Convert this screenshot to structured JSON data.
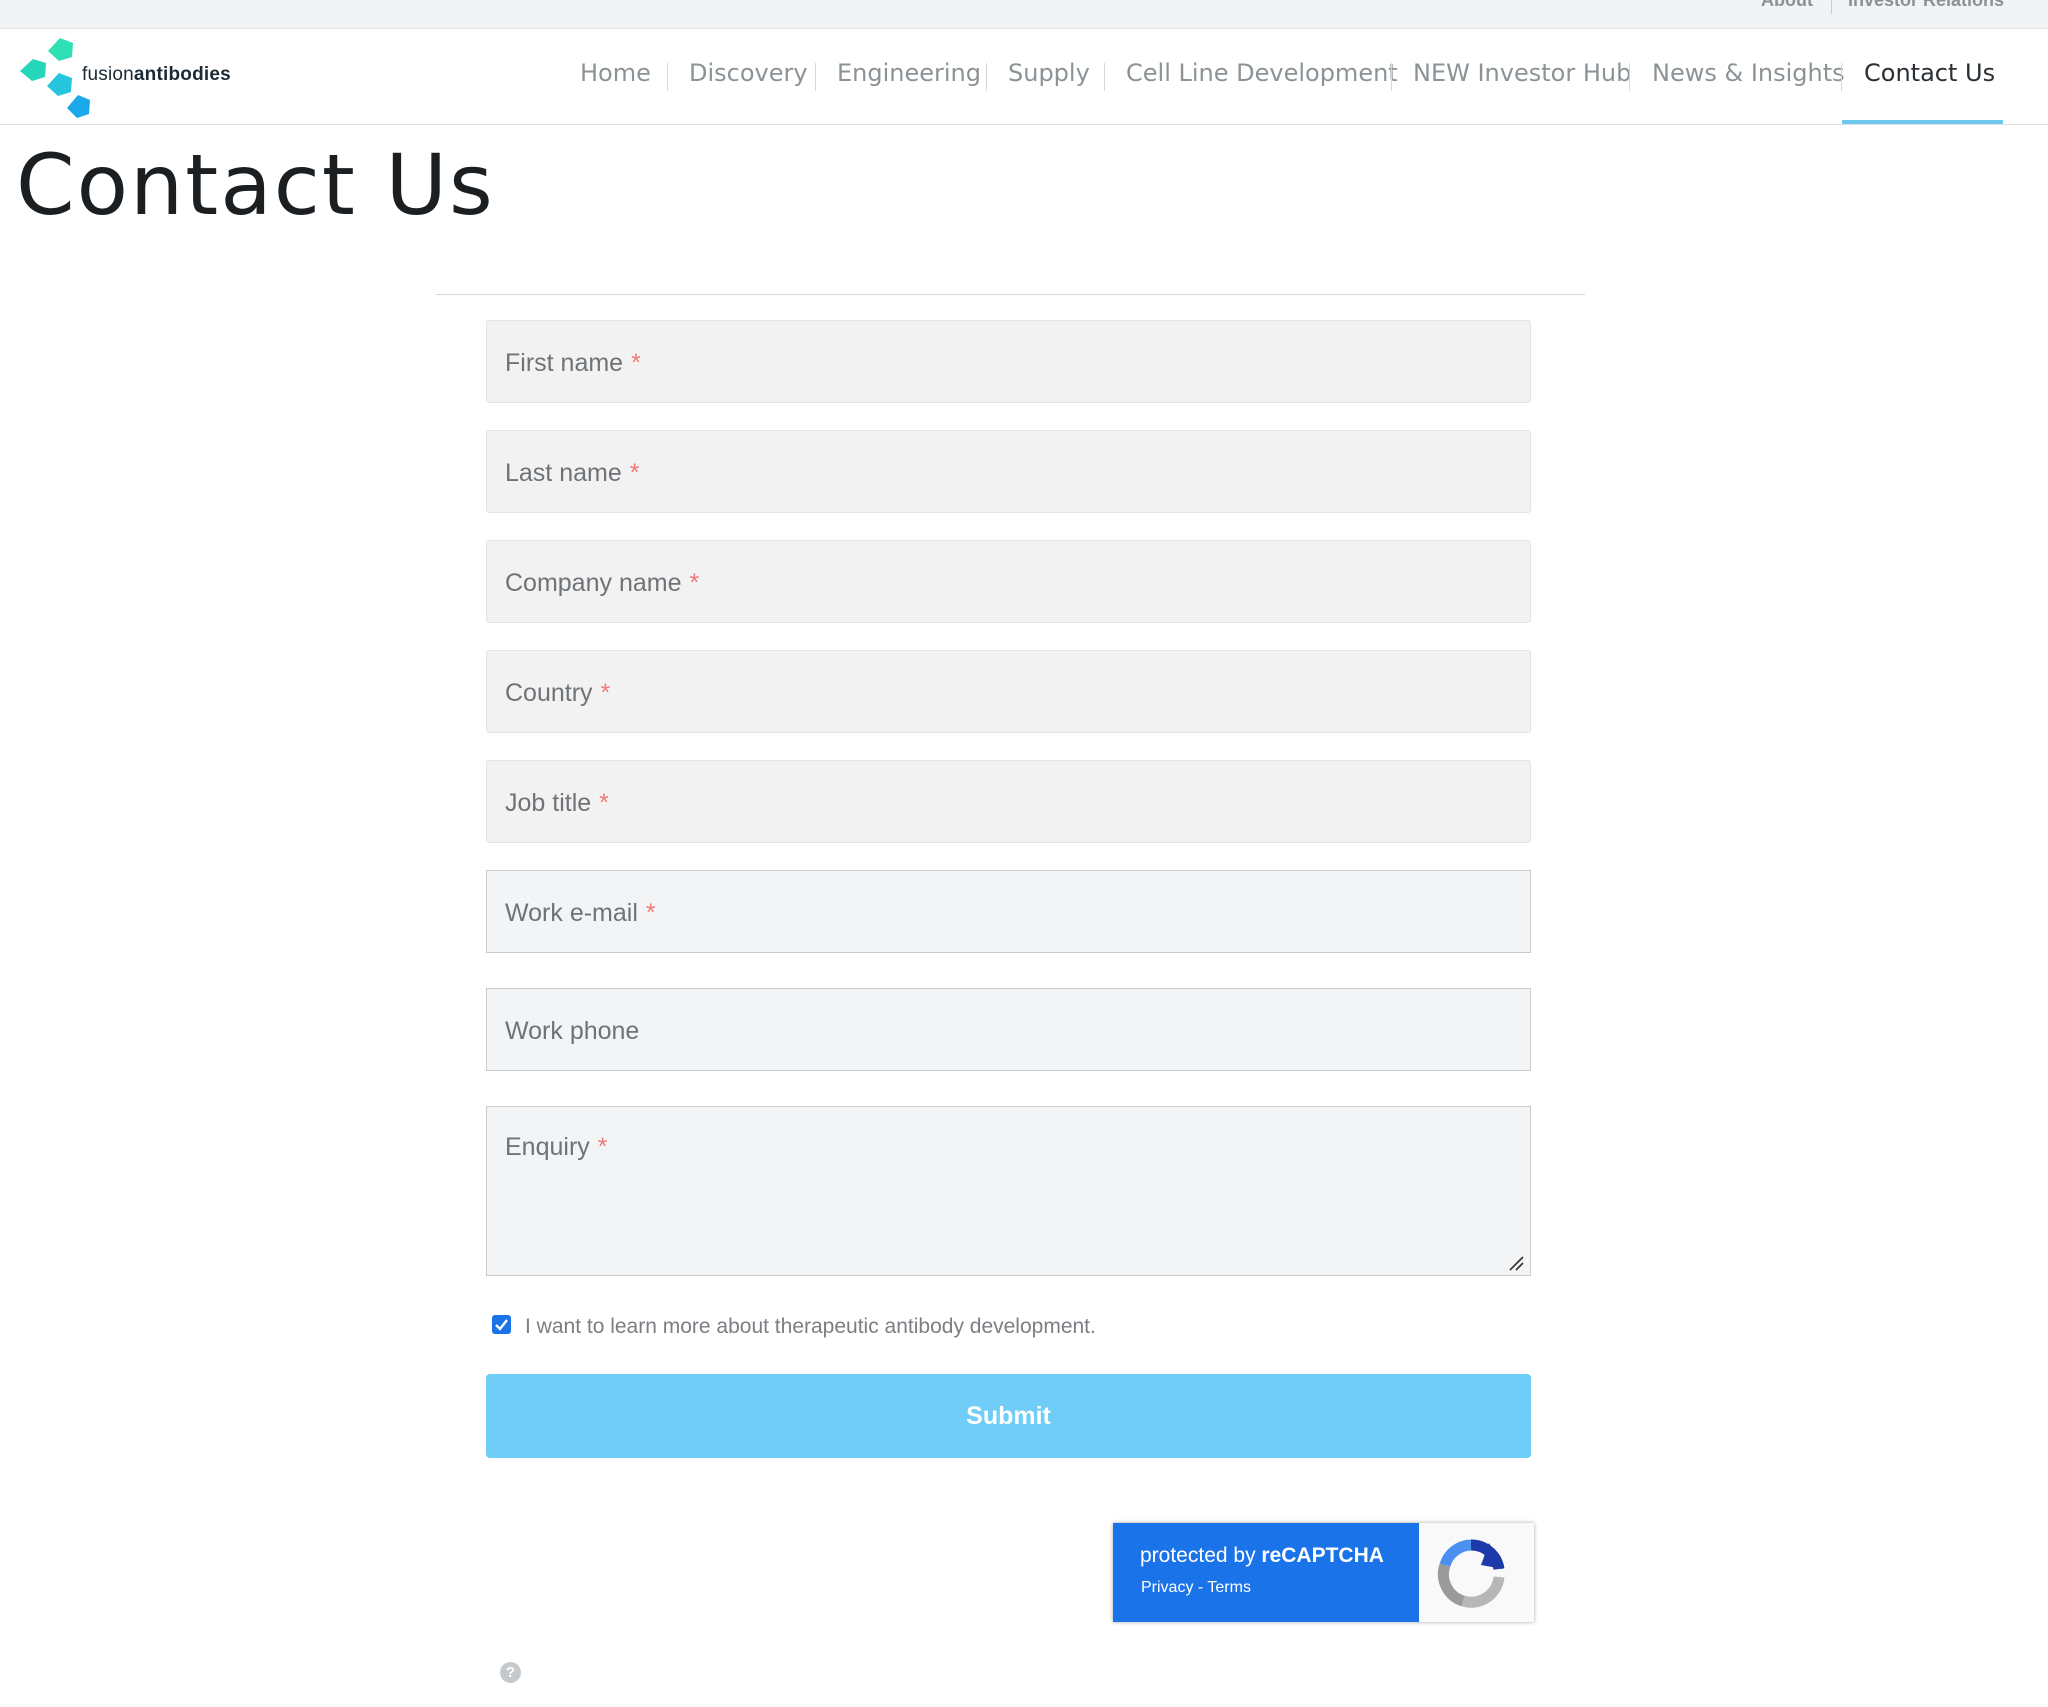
{
  "topbar": {
    "links": [
      "About",
      "Investor Relations"
    ]
  },
  "brand": {
    "name_light": "fusion",
    "name_bold": "antibodies",
    "colors": {
      "teal": "#2ee0b3",
      "cyan": "#25c5de",
      "blue": "#1aa8e8"
    }
  },
  "nav": {
    "items": [
      "Home",
      "Discovery",
      "Engineering",
      "Supply",
      "Cell Line Development",
      "NEW Investor Hub",
      "News & Insights",
      "Contact Us"
    ],
    "active": "Contact Us",
    "accent_color": "#6dc8ee"
  },
  "page": {
    "title": "Contact Us"
  },
  "form": {
    "required_marker": "*",
    "fields": [
      {
        "label": "First name",
        "required": true
      },
      {
        "label": "Last name",
        "required": true
      },
      {
        "label": "Company name",
        "required": true
      },
      {
        "label": "Country",
        "required": true
      },
      {
        "label": "Job title",
        "required": true
      },
      {
        "label": "Work e-mail",
        "required": true
      },
      {
        "label": "Work phone",
        "required": false
      },
      {
        "label": "Enquiry",
        "required": true
      }
    ],
    "consent_label": "I want to learn more about therapeutic antibody development.",
    "consent_checked": true,
    "submit_label": "Submit",
    "submit_color": "#6fcdf7"
  },
  "recaptcha": {
    "title_prefix": "protected by ",
    "title_brand": "reCAPTCHA",
    "privacy": "Privacy",
    "separator": " - ",
    "terms": "Terms",
    "color": "#1a73e8"
  },
  "help": {
    "icon": "question-icon",
    "glyph": "?"
  }
}
